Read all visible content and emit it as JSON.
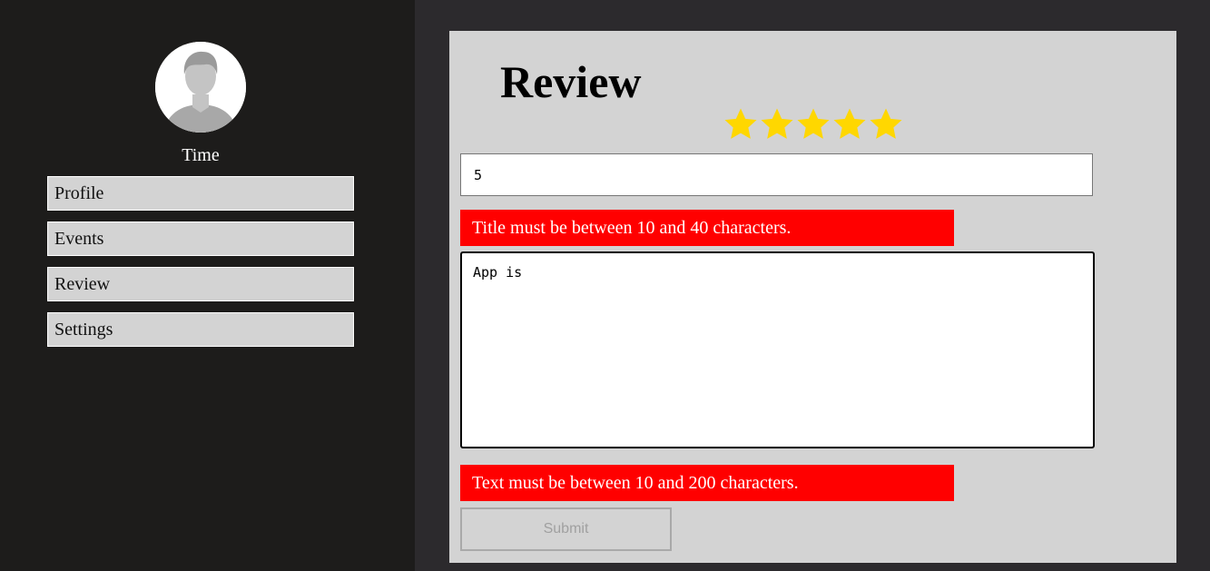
{
  "sidebar": {
    "username": "Time",
    "items": [
      {
        "label": "Profile"
      },
      {
        "label": "Events"
      },
      {
        "label": "Review"
      },
      {
        "label": "Settings"
      }
    ]
  },
  "main": {
    "title": "Review",
    "rating": 5,
    "rating_max": 5,
    "star_color": "#ffd700",
    "title_field": {
      "value": "5"
    },
    "title_error": "Title must be between 10 and 40 characters.",
    "text_field": {
      "value": "App is"
    },
    "text_error": "Text must be between 10 and 200 characters.",
    "submit_label": "Submit",
    "error_color": "#ff0000"
  }
}
